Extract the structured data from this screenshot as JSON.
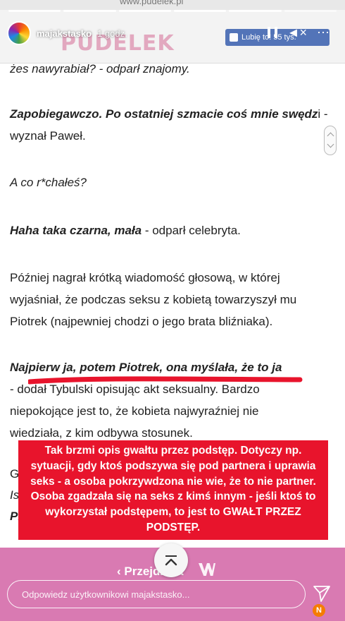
{
  "story": {
    "username": "majakstasko",
    "time": "1 godz.",
    "progress_total": 6,
    "progress_done": 5
  },
  "site": {
    "url": "www.pudelek.pl",
    "logo": "PUDELEK",
    "like_label": "Lubię to! 55 tys."
  },
  "article": {
    "line1": "żes nawyrabiał? - odparł znajomy.",
    "p2_bold": "Zapobiegawczo. Po ostatniej szmacie coś mnie swędz",
    "p2_rest": "i - wyznał Paweł.",
    "p3": "A co r*chałeś?",
    "p4_bold": "Haha taka czarna, mała",
    "p4_rest": " - odparł celebryta.",
    "p5": "Później nagrał krótką wiadomość głosową, w której wyjaśniał, że podczas seksu z kobietą towarzyszył mu Piotrek (najpewniej chodzi o jego brata bliźniaka).",
    "p6_bold": "Najpierw ja, potem Piotrek, ona myślała, że to ja",
    "p6_line2": "- dodał Tybulski opisując akt seksualny. Bardzo",
    "p6_line3": "niepokojące jest to, że kobieta najwyraźniej nie",
    "p6_line4": "wiedziała, z kim odbywa stosunek.",
    "partial1": "G",
    "partial2": "Is",
    "partial3": "Pi"
  },
  "annotation": {
    "text": "Tak brzmi opis gwałtu przez podstęp. Dotyczy np. sytuacji, gdy ktoś podszywa się pod partnera i uprawia seks - a osoba pokrzywdzona nie wie, że to nie partner. Osoba zgadzała się na seks z kimś innym - jeśli ktoś to wykorzystał podstępem, to jest to GWAŁT PRZEZ PODSTĘP."
  },
  "footer": {
    "back_label": "‹ Przejdź na",
    "reply_placeholder": "Odpowiedz użytkownikowi majakstasko...",
    "badge": "N"
  },
  "colors": {
    "red": "#e8142c",
    "pink": "#d97ab2",
    "like": "#4267b2"
  }
}
